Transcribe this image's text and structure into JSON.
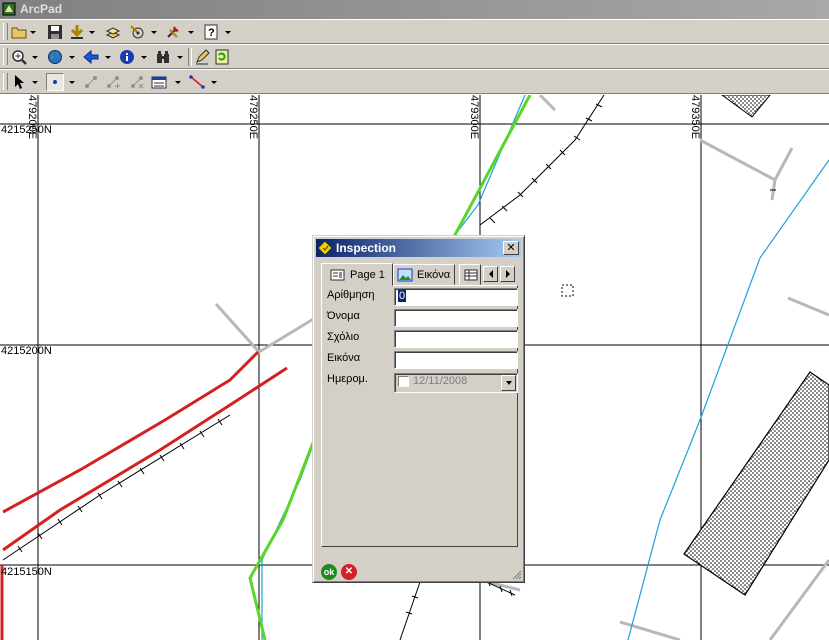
{
  "window": {
    "title": "ArcPad"
  },
  "map": {
    "grid_labels_x": [
      "479200E",
      "479250E",
      "479300E",
      "479350E"
    ],
    "grid_labels_y": [
      "4215250N",
      "4215200N",
      "4215150N"
    ]
  },
  "inspection": {
    "title": "Inspection",
    "close_glyph": "✕",
    "tabs": [
      {
        "label": "Page 1"
      },
      {
        "label": "Εικόνα"
      }
    ],
    "fields": [
      {
        "label": "Αρίθμηση",
        "value": "0"
      },
      {
        "label": "Όνομα",
        "value": ""
      },
      {
        "label": "Σχόλιο",
        "value": ""
      },
      {
        "label": "Εικόνα",
        "value": ""
      },
      {
        "label": "Ημερομ.",
        "value": "12/11/2008"
      }
    ],
    "ok_label": "ok",
    "cancel_glyph": "✕"
  },
  "colors": {
    "accent": "#0a246a",
    "road_red": "#d42020",
    "path_green": "#5ad52a",
    "river_blue": "#1ea0d8"
  }
}
